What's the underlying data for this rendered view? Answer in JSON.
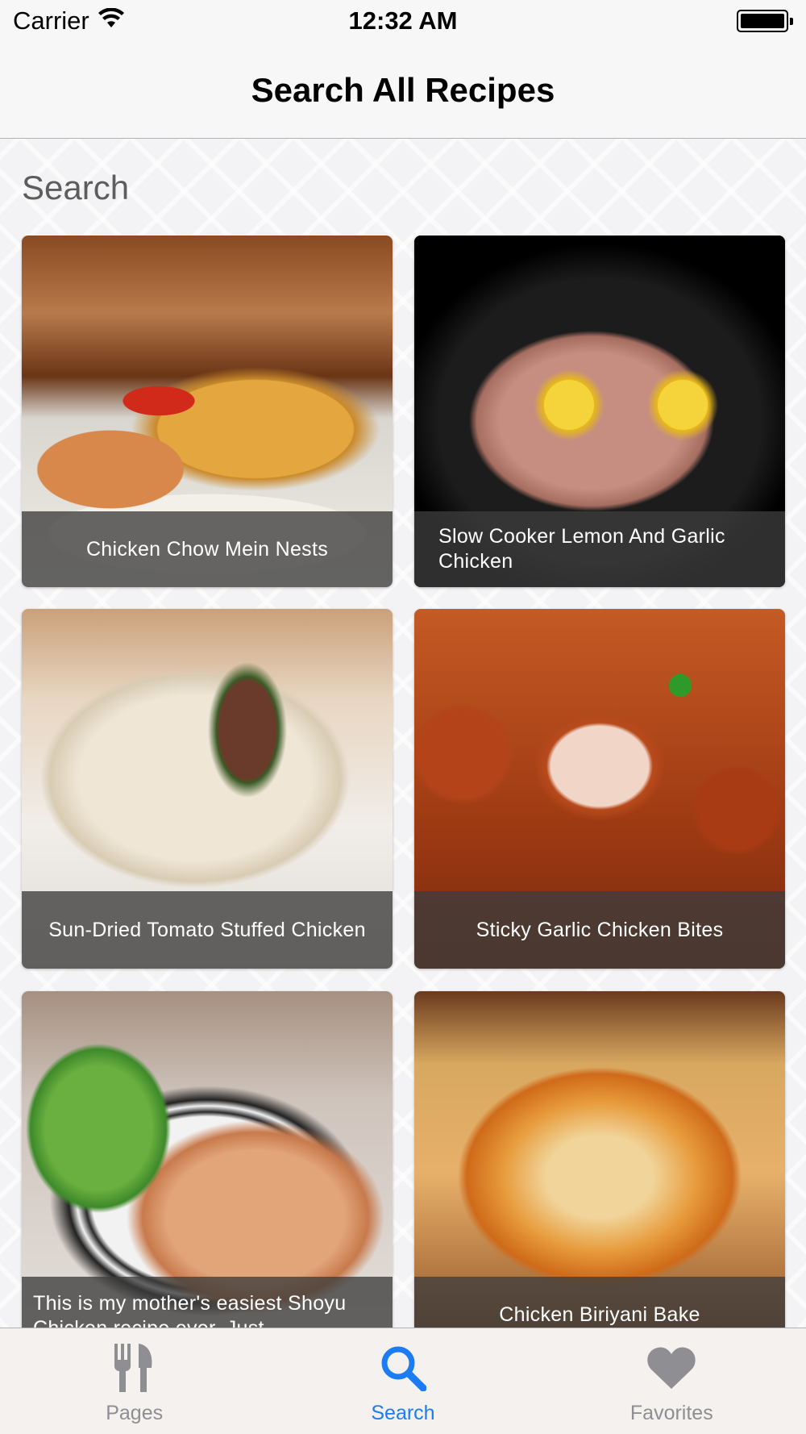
{
  "status_bar": {
    "carrier": "Carrier",
    "time": "12:32 AM",
    "wifi_icon": "wifi-icon",
    "battery_icon": "battery-icon"
  },
  "nav": {
    "title": "Search All Recipes"
  },
  "search": {
    "placeholder": "Search",
    "value": ""
  },
  "recipes": [
    {
      "title": "Chicken Chow Mein Nests"
    },
    {
      "title": "Slow Cooker Lemon And Garlic Chicken"
    },
    {
      "title": "Sun-Dried Tomato Stuffed Chicken"
    },
    {
      "title": "Sticky Garlic Chicken Bites"
    },
    {
      "title": "This is my mother's easiest Shoyu Chicken recipe ever. Just"
    },
    {
      "title": "Chicken Biriyani Bake"
    }
  ],
  "tab_bar": {
    "tabs": [
      {
        "label": "Pages",
        "icon": "fork-knife-icon",
        "selected": false
      },
      {
        "label": "Search",
        "icon": "search-icon",
        "selected": true
      },
      {
        "label": "Favorites",
        "icon": "heart-icon",
        "selected": false
      }
    ],
    "colors": {
      "active": "#1c7cf4",
      "inactive": "#8e8e93"
    }
  }
}
